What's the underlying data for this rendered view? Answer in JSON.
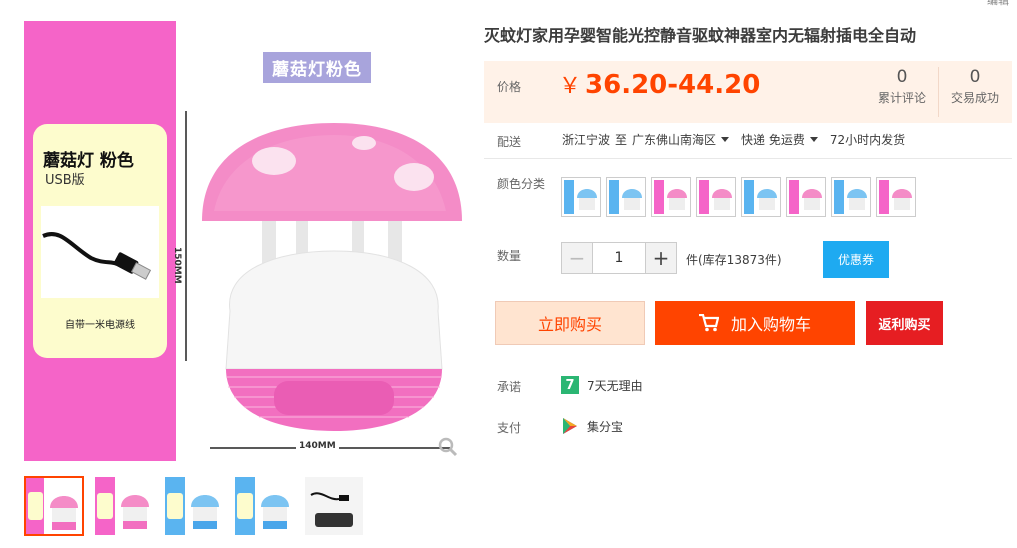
{
  "gallery": {
    "badge": "蘑菇灯粉色",
    "card_title": "蘑菇灯 粉色",
    "card_subtitle": "USB版",
    "card_caption": "自带一米电源线",
    "dim_height": "150MM",
    "dim_width": "140MM",
    "thumbnails": [
      {
        "name": "pink-card-lamp",
        "color": "#f564c8"
      },
      {
        "name": "pink-lamp",
        "color": "#f564c8"
      },
      {
        "name": "blue-lamp",
        "color": "#5ab4f0"
      },
      {
        "name": "blue-lamp-2",
        "color": "#5ab4f0"
      },
      {
        "name": "cable",
        "color": "#444444"
      }
    ]
  },
  "product": {
    "title": "灭蚊灯家用孕婴智能光控静音驱蚊神器室内无辐射插电全自动",
    "top_edit": "编辑"
  },
  "price": {
    "label": "价格",
    "currency": "￥",
    "value": "36.20-44.20",
    "reviews_count": "0",
    "reviews_label": "累计评论",
    "trades_count": "0",
    "trades_label": "交易成功"
  },
  "delivery": {
    "label": "配送",
    "from": "浙江宁波",
    "to_word": "至",
    "destination": "广东佛山南海区",
    "method": "快递 免运费",
    "dispatch": "72小时内发货"
  },
  "colors": {
    "label": "颜色分类",
    "options": [
      "blue",
      "blue",
      "pink",
      "pink",
      "blue",
      "pink",
      "blue",
      "pink"
    ]
  },
  "quantity": {
    "label": "数量",
    "value": "1",
    "unit_stock": "件(库存13873件)",
    "coupon": "优惠券"
  },
  "actions": {
    "buy_now": "立即购买",
    "add_cart": "加入购物车",
    "rebate_buy": "返利购买"
  },
  "promise": {
    "label": "承诺",
    "icon_text": "7",
    "text": "7天无理由"
  },
  "payment": {
    "label": "支付",
    "text": "集分宝"
  },
  "colors_theme": {
    "accent": "#ff4400",
    "price_bg": "#fff2e8",
    "coupon": "#1eaaf1",
    "rebate": "#e61e22",
    "lamp_pink": "#f564c8"
  }
}
